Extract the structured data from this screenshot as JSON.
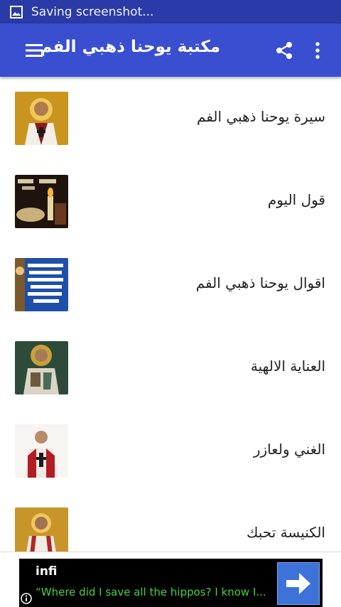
{
  "status_bar": {
    "notification_icon": "image-icon",
    "text": "Saving screenshot..."
  },
  "app_bar": {
    "menu_icon": "hamburger-menu-icon",
    "title": "مكتبة يوحنا ذهبي الفم",
    "share_icon": "share-icon",
    "more_icon": "more-vert-icon",
    "color": "#3a4fcf"
  },
  "list": {
    "items": [
      {
        "label": "سيرة يوحنا ذهبي الفم",
        "thumbnail": "saint-portrait-icon"
      },
      {
        "label": "قول اليوم",
        "thumbnail": "candle-book-icon"
      },
      {
        "label": "اقوال يوحنا ذهبي الفم",
        "thumbnail": "text-image-icon"
      },
      {
        "label": "العناية الالهية",
        "thumbnail": "mosaic-saint-icon"
      },
      {
        "label": "الغني ولعازر",
        "thumbnail": "saint-drawing-icon"
      },
      {
        "label": "الكنيسة تحبك",
        "thumbnail": "saint-icon"
      }
    ]
  },
  "ad": {
    "brand": "infi",
    "tagline": "“Where did I save all the hippos? I know I...",
    "info_icon": "info-icon",
    "action_icon": "arrow-right-icon"
  }
}
